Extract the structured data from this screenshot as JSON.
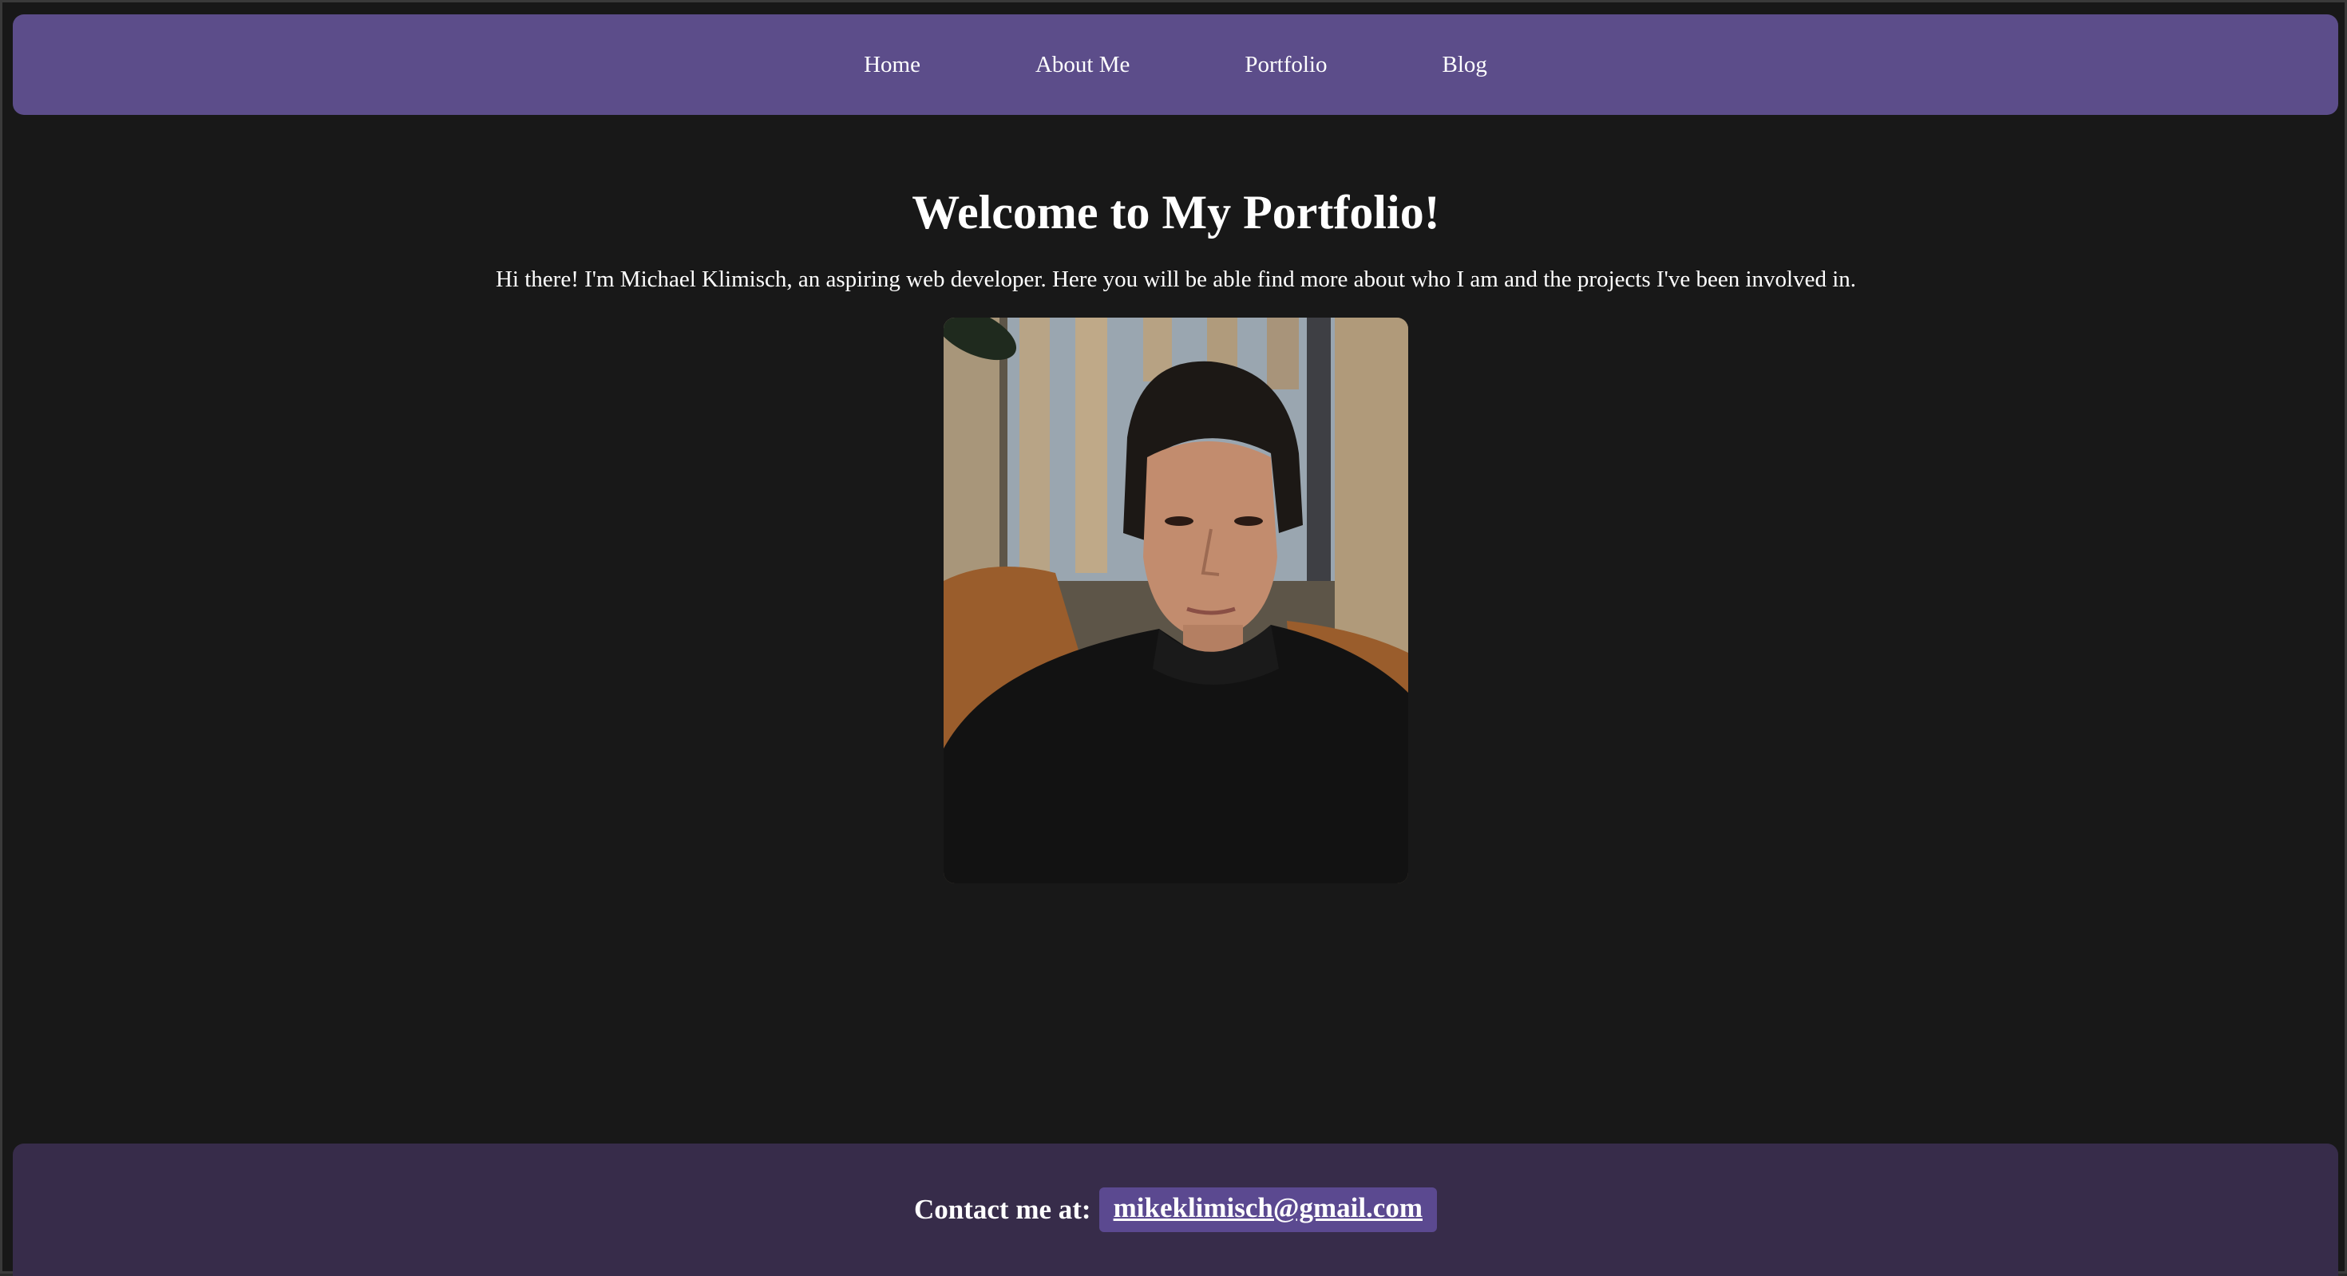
{
  "nav": {
    "items": [
      {
        "label": "Home"
      },
      {
        "label": "About Me"
      },
      {
        "label": "Portfolio"
      },
      {
        "label": "Blog"
      }
    ]
  },
  "main": {
    "title": "Welcome to My Portfolio!",
    "intro": "Hi there! I'm Michael Klimisch, an aspiring web developer. Here you will be able find more about who I am and the projects I've been involved in."
  },
  "footer": {
    "contact_label": "Contact me at:",
    "email": "mikeklimisch@gmail.com"
  },
  "colors": {
    "nav_bg": "#5c4d8a",
    "page_bg": "#181818",
    "footer_bg": "#372c4a",
    "email_bg": "#5b4990"
  }
}
